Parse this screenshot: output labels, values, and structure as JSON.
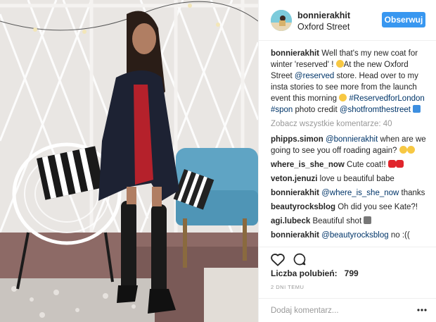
{
  "post": {
    "username": "bonnierakhit",
    "location": "Oxford Street",
    "follow_label": "Obserwuj",
    "caption_user": "bonnierakhit",
    "caption_text_1": "Well that's my new coat for winter 'reserved' ! ",
    "caption_text_2": "At the new Oxford Street ",
    "caption_mention": "@reserved",
    "caption_text_3": " store. Head over to my insta stories to see more from the launch event this morning ",
    "caption_tags": "#ReservedforLondon #spon",
    "caption_text_4": " photo credit ",
    "caption_credit": "@shotfromthestreet",
    "view_all_comments": "Zobacz wszystkie komentarze: 40"
  },
  "comments": [
    {
      "user": "phipps.simon",
      "mention": "@bonnierakhit",
      "text": " when are we going to see you off roading again?"
    },
    {
      "user": "where_is_she_now",
      "mention": "",
      "text": "Cute coat!! "
    },
    {
      "user": "veton.jenuzi",
      "mention": "",
      "text": "love u beautiful babe"
    },
    {
      "user": "bonnierakhit",
      "mention": "@where_is_she_now",
      "text": " thanks"
    },
    {
      "user": "beautyrocksblog",
      "mention": "",
      "text": "Oh did you see Kate?!"
    },
    {
      "user": "agi.lubeck",
      "mention": "",
      "text": "Beautiful shot "
    },
    {
      "user": "bonnierakhit",
      "mention": "@beautyrocksblog",
      "text": " no :(("
    }
  ],
  "actions": {
    "likes_label": "Liczba polubień:",
    "likes_count": "799",
    "time_ago": "2 DNI TEMU",
    "comment_placeholder": "Dodaj komentarz..."
  },
  "icons": {
    "like": "heart-icon",
    "comment": "comment-bubble-icon",
    "more": "more-options-icon"
  },
  "colors": {
    "follow_button": "#3897f0",
    "link": "#003569",
    "muted": "#999999"
  }
}
